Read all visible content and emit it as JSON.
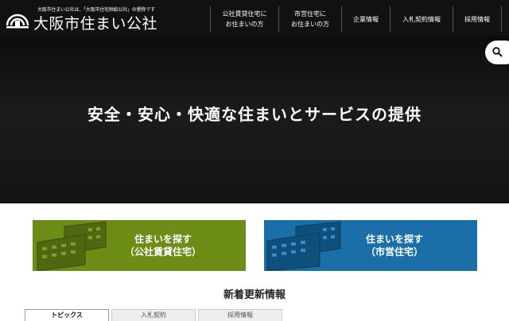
{
  "header": {
    "logo_sub": "大阪市住まい公社は、「大阪市住宅供給公社」の愛称です",
    "logo_name": "大阪市住まい公社",
    "logo_icon": "house-arc-logo-icon",
    "nav": [
      {
        "line1": "公社賃貸住宅に",
        "line2": "お住まいの方"
      },
      {
        "line1": "市営住宅に",
        "line2": "お住まいの方"
      },
      {
        "line1": "企業情報",
        "line2": ""
      },
      {
        "line1": "入札契約情報",
        "line2": ""
      },
      {
        "line1": "採用情報",
        "line2": ""
      }
    ]
  },
  "hero": {
    "title": "安全・安心・快適な住まいとサービスの提供",
    "search_icon": "search-icon"
  },
  "cards": [
    {
      "line1": "住まいを探す",
      "line2": "（公社賃貸住宅）",
      "color": "#6c8c16"
    },
    {
      "line1": "住まいを探す",
      "line2": "（市営住宅）",
      "color": "#1a6fa8"
    }
  ],
  "news": {
    "title": "新着更新情報",
    "tabs": [
      "トピックス",
      "入札契約",
      "採用情報"
    ]
  },
  "colors": {
    "header_bg": "#111111",
    "accent_green": "#6c8c16",
    "accent_blue": "#1a6fa8"
  }
}
